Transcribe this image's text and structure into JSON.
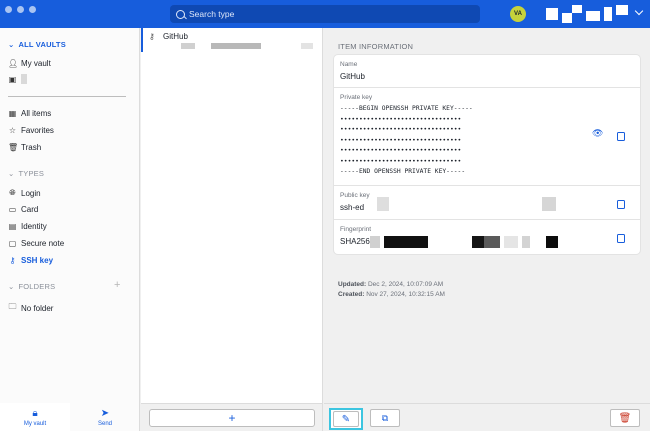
{
  "topbar": {
    "search_placeholder": "Search type",
    "avatar_initials": "VA",
    "accent": "#175ddc"
  },
  "sidebar": {
    "all_vaults": "ALL VAULTS",
    "vaults": [
      {
        "label": "My vault"
      }
    ],
    "filters": [
      {
        "label": "All items",
        "icon": "grid-icon"
      },
      {
        "label": "Favorites",
        "icon": "star-icon"
      },
      {
        "label": "Trash",
        "icon": "trash-icon"
      }
    ],
    "types_header": "TYPES",
    "types": [
      {
        "label": "Login",
        "icon": "globe-icon"
      },
      {
        "label": "Card",
        "icon": "card-icon"
      },
      {
        "label": "Identity",
        "icon": "id-icon"
      },
      {
        "label": "Secure note",
        "icon": "note-icon"
      },
      {
        "label": "SSH key",
        "icon": "key-icon",
        "active": true
      }
    ],
    "folders_header": "FOLDERS",
    "folders": [
      {
        "label": "No folder"
      }
    ],
    "tabs": [
      {
        "label": "My vault",
        "active": true
      },
      {
        "label": "Send"
      }
    ]
  },
  "list": {
    "items": [
      {
        "name": "GitHub"
      }
    ]
  },
  "details": {
    "section_title": "ITEM INFORMATION",
    "name_label": "Name",
    "name_value": "GitHub",
    "private_key_label": "Private key",
    "private_key_value": "-----BEGIN OPENSSH PRIVATE KEY-----\n••••••••••••••••••••••••••••••••\n••••••••••••••••••••••••••••••••\n••••••••••••••••••••••••••••••••\n••••••••••••••••••••••••••••••••\n••••••••••••••••••••••••••••••••\n-----END OPENSSH PRIVATE KEY-----",
    "public_key_label": "Public key",
    "public_key_value": "ssh-ed",
    "fingerprint_label": "Fingerprint",
    "fingerprint_value": "SHA256:",
    "updated_label": "Updated:",
    "updated_value": "Dec 2, 2024, 10:07:09 AM",
    "created_label": "Created:",
    "created_value": "Nov 27, 2024, 10:32:15 AM"
  }
}
